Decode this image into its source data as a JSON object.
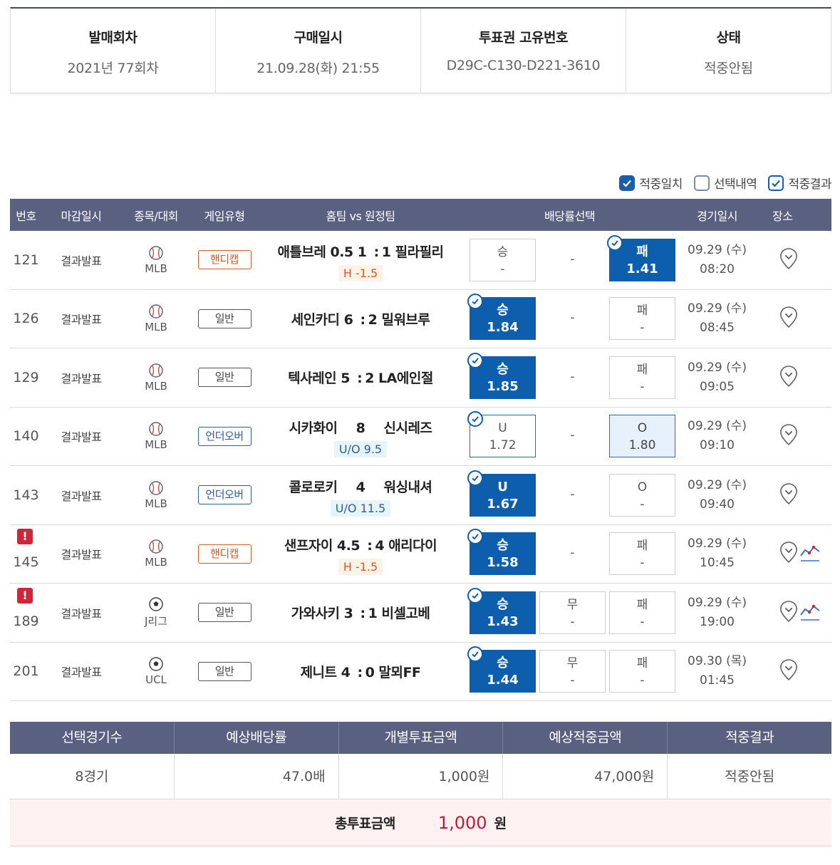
{
  "info": [
    {
      "header": "발매회차",
      "value": "2021년 77회차"
    },
    {
      "header": "구매일시",
      "value": "21.09.28(화) 21:55"
    },
    {
      "header": "투표권 고유번호",
      "value": "D29C-C130-D221-3610"
    },
    {
      "header": "상태",
      "value": "적중안됨"
    }
  ],
  "filters": [
    {
      "label": "적중일치",
      "checked": true
    },
    {
      "label": "선택내역",
      "checked": false
    },
    {
      "label": "적중결과",
      "checked": true
    }
  ],
  "table": {
    "headers": [
      "번호",
      "마감일시",
      "종목/대회",
      "게임유형",
      "홈팀 vs 원정팀",
      "배당률선택",
      "경기일시",
      "장소"
    ],
    "rows": [
      {
        "no": "121",
        "deadline": "결과발표",
        "sport": "MLB",
        "icon": "baseball-icon",
        "type": "핸디캡",
        "home": "애틀브레 0.5",
        "hs": "1",
        "sep": ":",
        "as": "1",
        "away": "필라필리",
        "sub": "H -1.5",
        "o1": {
          "label": "승",
          "val": "-"
        },
        "o2": {
          "label": "",
          "val": "-"
        },
        "o3": {
          "label": "패",
          "val": "1.41"
        },
        "date": "09.29 (수)",
        "time": "08:20",
        "warn": ""
      },
      {
        "no": "126",
        "deadline": "결과발표",
        "sport": "MLB",
        "icon": "baseball-icon",
        "type": "일반",
        "home": "세인카디",
        "hs": "6",
        "sep": ":",
        "as": "2",
        "away": "밀워브루",
        "sub": "",
        "o1": {
          "label": "승",
          "val": "1.84"
        },
        "o2": {
          "label": "",
          "val": "-"
        },
        "o3": {
          "label": "패",
          "val": "-"
        },
        "date": "09.29 (수)",
        "time": "08:45",
        "warn": ""
      },
      {
        "no": "129",
        "deadline": "결과발표",
        "sport": "MLB",
        "icon": "baseball-icon",
        "type": "일반",
        "home": "텍사레인",
        "hs": "5",
        "sep": ":",
        "as": "2",
        "away": "LA에인절",
        "sub": "",
        "o1": {
          "label": "승",
          "val": "1.85"
        },
        "o2": {
          "label": "",
          "val": "-"
        },
        "o3": {
          "label": "패",
          "val": "-"
        },
        "date": "09.29 (수)",
        "time": "09:05",
        "warn": ""
      },
      {
        "no": "140",
        "deadline": "결과발표",
        "sport": "MLB",
        "icon": "baseball-icon",
        "type": "언더오버",
        "home": "시카화이",
        "hs": "8",
        "sep": "",
        "as": "",
        "away": "신시레즈",
        "sub": "U/O 9.5",
        "o1": {
          "label": "U",
          "val": "1.72"
        },
        "o2": {
          "label": "",
          "val": "-"
        },
        "o3": {
          "label": "O",
          "val": "1.80"
        },
        "date": "09.29 (수)",
        "time": "09:10",
        "warn": ""
      },
      {
        "no": "143",
        "deadline": "결과발표",
        "sport": "MLB",
        "icon": "baseball-icon",
        "type": "언더오버",
        "home": "콜로로키",
        "hs": "4",
        "sep": "",
        "as": "",
        "away": "워싱내셔",
        "sub": "U/O 11.5",
        "o1": {
          "label": "U",
          "val": "1.67"
        },
        "o2": {
          "label": "",
          "val": "-"
        },
        "o3": {
          "label": "O",
          "val": "-"
        },
        "date": "09.29 (수)",
        "time": "09:40",
        "warn": ""
      },
      {
        "no": "145",
        "deadline": "결과발표",
        "sport": "MLB",
        "icon": "baseball-icon",
        "type": "핸디캡",
        "home": "샌프자이 4.5",
        "hs": "",
        "sep": ":",
        "as": "4",
        "away": "애리다이",
        "sub": "H -1.5",
        "o1": {
          "label": "승",
          "val": "1.58"
        },
        "o2": {
          "label": "",
          "val": "-"
        },
        "o3": {
          "label": "패",
          "val": "-"
        },
        "date": "09.29 (수)",
        "time": "10:45",
        "warn": "!"
      },
      {
        "no": "189",
        "deadline": "결과발표",
        "sport": "J리그",
        "icon": "soccer-ball-icon",
        "type": "일반",
        "home": "가와사키",
        "hs": "3",
        "sep": ":",
        "as": "1",
        "away": "비셀고베",
        "sub": "",
        "o1": {
          "label": "승",
          "val": "1.43"
        },
        "o2": {
          "label": "무",
          "val": "-"
        },
        "o3": {
          "label": "패",
          "val": "-"
        },
        "date": "09.29 (수)",
        "time": "19:00",
        "warn": "!"
      },
      {
        "no": "201",
        "deadline": "결과발표",
        "sport": "UCL",
        "icon": "soccer-ball-icon",
        "type": "일반",
        "home": "제니트",
        "hs": "4",
        "sep": ":",
        "as": "0",
        "away": "말뫼FF",
        "sub": "",
        "o1": {
          "label": "승",
          "val": "1.44"
        },
        "o2": {
          "label": "무",
          "val": "-"
        },
        "o3": {
          "label": "패",
          "val": "-"
        },
        "date": "09.30 (목)",
        "time": "01:45",
        "warn": ""
      }
    ]
  },
  "summary": {
    "headers": [
      "선택경기수",
      "예상배당률",
      "개별투표금액",
      "예상적중금액",
      "적중결과"
    ],
    "values": [
      "8경기",
      "47.0배",
      "1,000원",
      "47,000원",
      "적중안됨"
    ],
    "total_label": "총투표금액",
    "total_amount": "1,000",
    "total_unit": "원"
  },
  "colors": {
    "header_bg": "#5a6180",
    "selected": "#0d5fad",
    "handicap": "#d85a24",
    "warn": "#d0263a",
    "total_amount": "#c01b2f"
  }
}
